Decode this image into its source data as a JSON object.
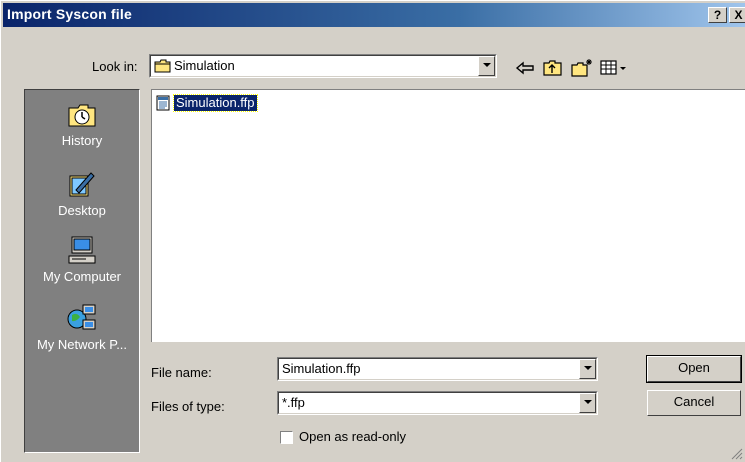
{
  "window": {
    "title": "Import Syscon file",
    "help_button": "?",
    "close_button": "X"
  },
  "look_in": {
    "label": "Look in:",
    "value": "Simulation",
    "icon": "folder-icon"
  },
  "toolbar": {
    "icons": [
      "back-arrow-icon",
      "up-folder-icon",
      "new-folder-icon",
      "view-menu-icon"
    ]
  },
  "places": [
    {
      "label": "History",
      "icon": "history-icon"
    },
    {
      "label": "Desktop",
      "icon": "desktop-icon"
    },
    {
      "label": "My Computer",
      "icon": "my-computer-icon"
    },
    {
      "label": "My Network P...",
      "icon": "my-network-places-icon"
    }
  ],
  "files": [
    {
      "name": "Simulation.ffp",
      "icon": "document-icon",
      "selected": true
    }
  ],
  "file_name": {
    "label": "File name:",
    "value": "Simulation.ffp"
  },
  "file_type": {
    "label": "Files of type:",
    "value": "*.ffp"
  },
  "read_only": {
    "label": "Open as read-only",
    "checked": false
  },
  "buttons": {
    "open": "Open",
    "cancel": "Cancel"
  },
  "colors": {
    "title_bar": "#0a246a",
    "face": "#d4d0c8",
    "selection": "#0a246a",
    "places_bg": "#808080"
  }
}
